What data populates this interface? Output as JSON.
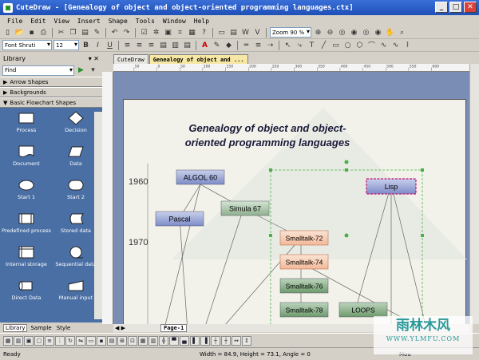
{
  "window": {
    "title": "CuteDraw - [Genealogy of object and object-oriented programming languages.ctx]"
  },
  "menu": [
    "File",
    "Edit",
    "View",
    "Insert",
    "Shape",
    "Tools",
    "Window",
    "Help"
  ],
  "toolbar": {
    "zoom_value": "Zoom 90 %",
    "font_name": "Font Shruti",
    "font_size": "12",
    "bold": "B",
    "italic": "I",
    "underline": "U"
  },
  "library": {
    "title": "Library",
    "find_label": "Find",
    "categories": [
      "Arrow Shapes",
      "Backgrounds",
      "Basic Flowchart Shapes"
    ],
    "shapes": [
      "Process",
      "Decision",
      "Document",
      "Data",
      "Start 1",
      "Start 2",
      "Predefined process",
      "Stored data",
      "Internal storage",
      "Sequential data",
      "Direct Data",
      "Manual input"
    ],
    "tabs": [
      "Library",
      "Sample",
      "Style"
    ]
  },
  "doc_tabs": [
    "CuteDraw",
    "Genealogy of object and ..."
  ],
  "page_tab": "Page-1",
  "diagram": {
    "title_line1": "Genealogy of object and object-",
    "title_line2": "oriented programming languages",
    "years": [
      "1960",
      "1970"
    ],
    "nodes": [
      "ALGOL 60",
      "Pascal",
      "Simula 67",
      "Lisp",
      "Smalltalk-72",
      "Smalltalk-74",
      "Smalltalk-76",
      "Smalltalk-78",
      "LOOPS"
    ]
  },
  "ruler_ticks": [
    "50",
    "0",
    "50",
    "100",
    "150",
    "200",
    "250",
    "300",
    "350",
    "400",
    "450",
    "500",
    "550",
    "600"
  ],
  "status": {
    "ready": "Ready",
    "dims": "Width = 84.9, Height = 73.1, Angle = 0",
    "mode": "Mou"
  },
  "watermark": {
    "big": "雨林木风",
    "small": "WWW.YLMFU.COM"
  },
  "colors": {
    "title_blue": "#1f4fb8",
    "panel_blue": "#4a6fa5",
    "canvas_bg": "#7a8db5"
  }
}
